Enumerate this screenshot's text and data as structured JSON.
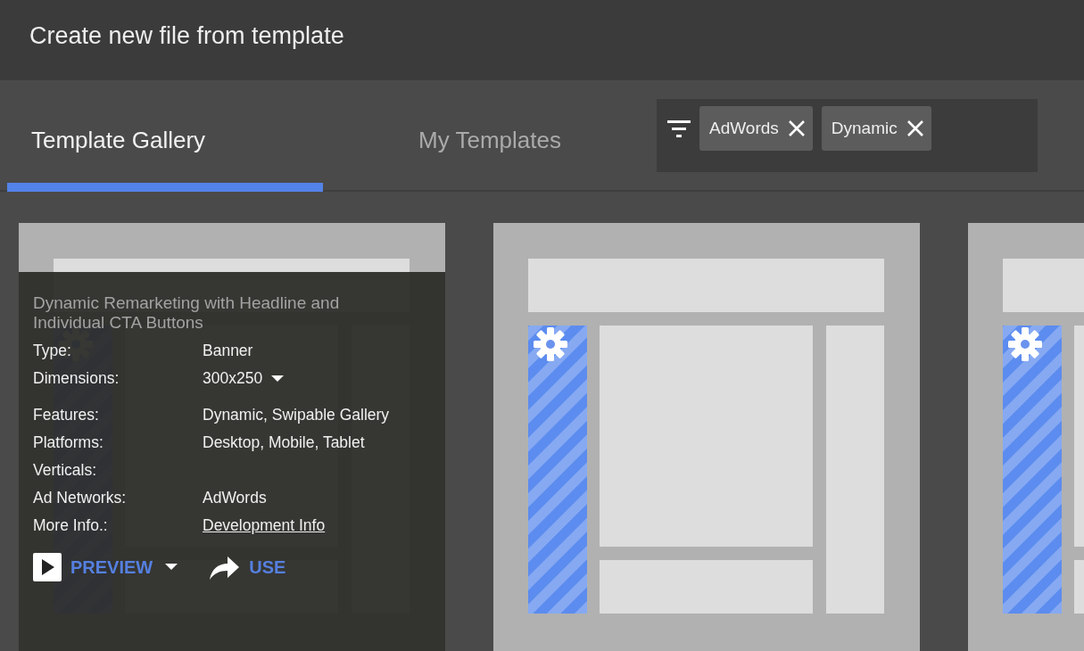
{
  "window": {
    "title": "Create new file from template"
  },
  "tabs": [
    {
      "label": "Template Gallery",
      "selected": true
    },
    {
      "label": "My Templates",
      "selected": false
    }
  ],
  "filters": [
    {
      "label": "AdWords"
    },
    {
      "label": "Dynamic"
    }
  ],
  "templates": [
    {
      "hovered": true,
      "title": "Dynamic Remarketing with Headline and Individual CTA Buttons",
      "fields": [
        {
          "label": "Type:",
          "value": "Banner",
          "kind": "text"
        },
        {
          "label": "Dimensions:",
          "value": "300x250",
          "kind": "dropdown"
        },
        {
          "label": "Features:",
          "value": "Dynamic, Swipable Gallery",
          "kind": "text"
        },
        {
          "label": "Platforms:",
          "value": "Desktop, Mobile, Tablet",
          "kind": "text"
        },
        {
          "label": "Verticals:",
          "kind": "text"
        },
        {
          "label": "Ad Networks:",
          "value": "AdWords",
          "kind": "text"
        },
        {
          "label": "More Info.:",
          "value": "Development Info",
          "kind": "link"
        }
      ],
      "actions": [
        {
          "label": "PREVIEW",
          "kind": "preview"
        },
        {
          "label": "USE",
          "kind": "use"
        }
      ]
    },
    {
      "hovered": false
    },
    {
      "hovered": false
    }
  ]
}
